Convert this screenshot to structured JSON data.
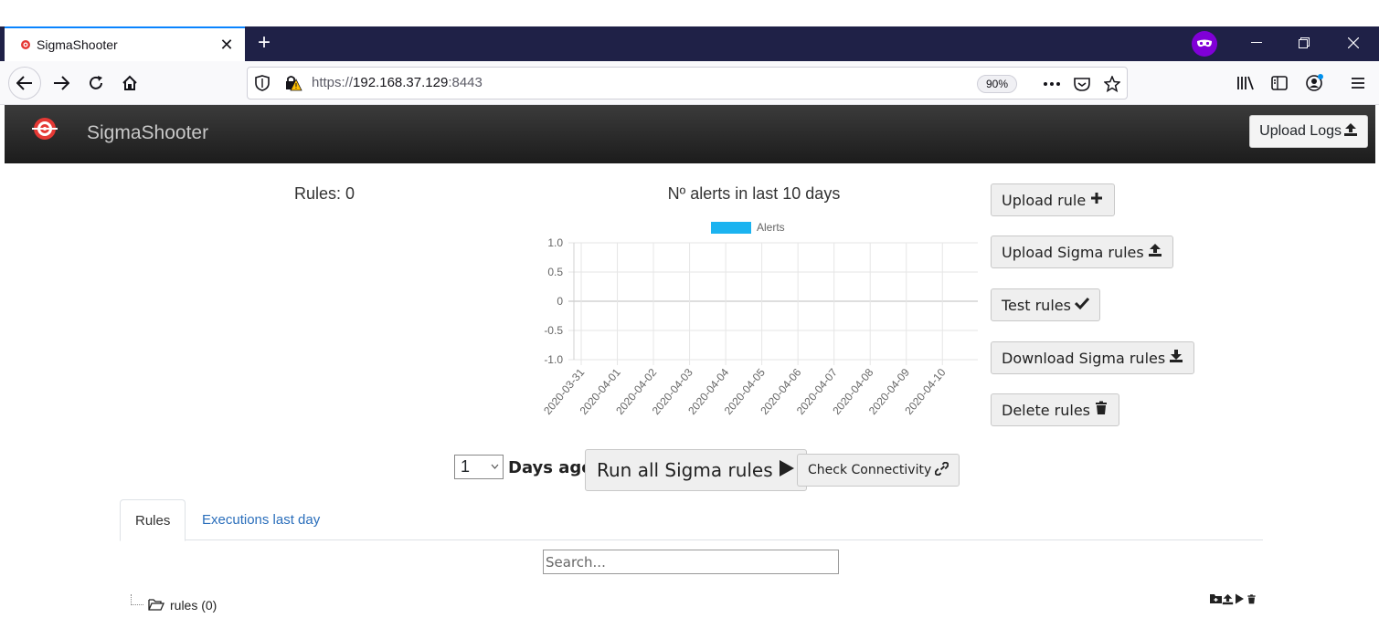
{
  "browser": {
    "tab_title": "SigmaShooter",
    "url_scheme": "https://",
    "url_host": "192.168.37.129",
    "url_port": ":8443",
    "zoom": "90%",
    "new_tab_glyph": "+",
    "close_glyph": "✕"
  },
  "app": {
    "brand": "SigmaShooter",
    "upload_logs_label": "Upload Logs"
  },
  "main": {
    "rules_count_label": "Rules: 0",
    "chart_title": "Nº alerts in last 10 days",
    "side_buttons": {
      "upload_rule": "Upload rule",
      "upload_sigma_rules": "Upload Sigma rules",
      "test_rules": "Test rules",
      "download_sigma_rules": "Download Sigma rules",
      "delete_rules": "Delete rules"
    },
    "days_value": "1",
    "days_label": "Days ago",
    "run_all_label": "Run all Sigma rules",
    "check_connectivity_label": "Check Connectivity",
    "tabs": {
      "rules": "Rules",
      "executions": "Executions last day"
    },
    "search_placeholder": "Search...",
    "tree_root_label": "rules (0)"
  },
  "colors": {
    "tabbar": "#1f2147",
    "header_dark": "#1c1c1c",
    "series_alerts": "#1bb3f0",
    "link": "#2a6ebb"
  },
  "chart_data": {
    "type": "line",
    "title": "Nº alerts in last 10 days",
    "legend": [
      "Alerts"
    ],
    "legend_position": "top",
    "categories": [
      "2020-03-31",
      "2020-04-01",
      "2020-04-02",
      "2020-04-03",
      "2020-04-04",
      "2020-04-05",
      "2020-04-06",
      "2020-04-07",
      "2020-04-08",
      "2020-04-09",
      "2020-04-10"
    ],
    "series": [
      {
        "name": "Alerts",
        "values": [
          0,
          0,
          0,
          0,
          0,
          0,
          0,
          0,
          0,
          0,
          0
        ]
      }
    ],
    "y_ticks": [
      "1.0",
      "0.5",
      "0",
      "-0.5",
      "-1.0"
    ],
    "ylim": [
      -1,
      1
    ],
    "grid": true
  }
}
